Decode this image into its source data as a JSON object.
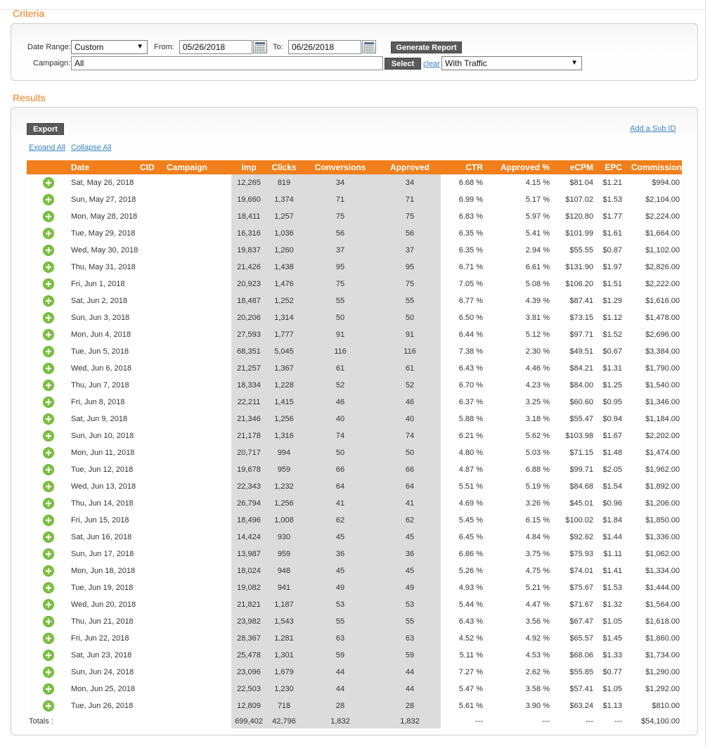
{
  "criteria": {
    "title": "Criteria",
    "date_range_label": "Date Range:",
    "date_range_value": "Custom",
    "from_label": "From:",
    "from_value": "05/26/2018",
    "to_label": "To:",
    "to_value": "06/26/2018",
    "generate_label": "Generate Report",
    "campaign_label": "Campaign:",
    "campaign_value": "All",
    "select_label": "Select",
    "clear_label": "clear",
    "traffic_value": "With Traffic"
  },
  "results": {
    "title": "Results",
    "export_label": "Export",
    "add_sub_id_label": "Add a Sub ID",
    "expand_all_label": "Expand All",
    "collapse_all_label": "Collapse All",
    "columns": [
      "Date",
      "CID",
      "Campaign",
      "Imp",
      "Clicks",
      "Conversions",
      "Approved",
      "CTR",
      "Approved %",
      "eCPM",
      "EPC",
      "Commission"
    ],
    "rows": [
      {
        "date": "Sat, May 26, 2018",
        "imp": "12,265",
        "clicks": "819",
        "conv": "34",
        "appr": "34",
        "ctr": "6.68 %",
        "apct": "4.15 %",
        "ecpm": "$81.04",
        "epc": "$1.21",
        "comm": "$994.00"
      },
      {
        "date": "Sun, May 27, 2018",
        "imp": "19,660",
        "clicks": "1,374",
        "conv": "71",
        "appr": "71",
        "ctr": "6.99 %",
        "apct": "5.17 %",
        "ecpm": "$107.02",
        "epc": "$1.53",
        "comm": "$2,104.00"
      },
      {
        "date": "Mon, May 28, 2018",
        "imp": "18,411",
        "clicks": "1,257",
        "conv": "75",
        "appr": "75",
        "ctr": "6.83 %",
        "apct": "5.97 %",
        "ecpm": "$120.80",
        "epc": "$1.77",
        "comm": "$2,224.00"
      },
      {
        "date": "Tue, May 29, 2018",
        "imp": "16,316",
        "clicks": "1,036",
        "conv": "56",
        "appr": "56",
        "ctr": "6.35 %",
        "apct": "5.41 %",
        "ecpm": "$101.99",
        "epc": "$1.61",
        "comm": "$1,664.00"
      },
      {
        "date": "Wed, May 30, 2018",
        "imp": "19,837",
        "clicks": "1,260",
        "conv": "37",
        "appr": "37",
        "ctr": "6.35 %",
        "apct": "2.94 %",
        "ecpm": "$55.55",
        "epc": "$0.87",
        "comm": "$1,102.00"
      },
      {
        "date": "Thu, May 31, 2018",
        "imp": "21,426",
        "clicks": "1,438",
        "conv": "95",
        "appr": "95",
        "ctr": "6.71 %",
        "apct": "6.61 %",
        "ecpm": "$131.90",
        "epc": "$1.97",
        "comm": "$2,826.00"
      },
      {
        "date": "Fri, Jun 1, 2018",
        "imp": "20,923",
        "clicks": "1,476",
        "conv": "75",
        "appr": "75",
        "ctr": "7.05 %",
        "apct": "5.08 %",
        "ecpm": "$106.20",
        "epc": "$1.51",
        "comm": "$2,222.00"
      },
      {
        "date": "Sat, Jun 2, 2018",
        "imp": "18,487",
        "clicks": "1,252",
        "conv": "55",
        "appr": "55",
        "ctr": "6.77 %",
        "apct": "4.39 %",
        "ecpm": "$87.41",
        "epc": "$1.29",
        "comm": "$1,616.00"
      },
      {
        "date": "Sun, Jun 3, 2018",
        "imp": "20,206",
        "clicks": "1,314",
        "conv": "50",
        "appr": "50",
        "ctr": "6.50 %",
        "apct": "3.81 %",
        "ecpm": "$73.15",
        "epc": "$1.12",
        "comm": "$1,478.00"
      },
      {
        "date": "Mon, Jun 4, 2018",
        "imp": "27,593",
        "clicks": "1,777",
        "conv": "91",
        "appr": "91",
        "ctr": "6.44 %",
        "apct": "5.12 %",
        "ecpm": "$97.71",
        "epc": "$1.52",
        "comm": "$2,696.00"
      },
      {
        "date": "Tue, Jun 5, 2018",
        "imp": "68,351",
        "clicks": "5,045",
        "conv": "116",
        "appr": "116",
        "ctr": "7.38 %",
        "apct": "2.30 %",
        "ecpm": "$49.51",
        "epc": "$0.67",
        "comm": "$3,384.00"
      },
      {
        "date": "Wed, Jun 6, 2018",
        "imp": "21,257",
        "clicks": "1,367",
        "conv": "61",
        "appr": "61",
        "ctr": "6.43 %",
        "apct": "4.46 %",
        "ecpm": "$84.21",
        "epc": "$1.31",
        "comm": "$1,790.00"
      },
      {
        "date": "Thu, Jun 7, 2018",
        "imp": "18,334",
        "clicks": "1,228",
        "conv": "52",
        "appr": "52",
        "ctr": "6.70 %",
        "apct": "4.23 %",
        "ecpm": "$84.00",
        "epc": "$1.25",
        "comm": "$1,540.00"
      },
      {
        "date": "Fri, Jun 8, 2018",
        "imp": "22,211",
        "clicks": "1,415",
        "conv": "46",
        "appr": "46",
        "ctr": "6.37 %",
        "apct": "3.25 %",
        "ecpm": "$60.60",
        "epc": "$0.95",
        "comm": "$1,346.00"
      },
      {
        "date": "Sat, Jun 9, 2018",
        "imp": "21,346",
        "clicks": "1,256",
        "conv": "40",
        "appr": "40",
        "ctr": "5.88 %",
        "apct": "3.18 %",
        "ecpm": "$55.47",
        "epc": "$0.94",
        "comm": "$1,184.00"
      },
      {
        "date": "Sun, Jun 10, 2018",
        "imp": "21,178",
        "clicks": "1,316",
        "conv": "74",
        "appr": "74",
        "ctr": "6.21 %",
        "apct": "5.62 %",
        "ecpm": "$103.98",
        "epc": "$1.67",
        "comm": "$2,202.00"
      },
      {
        "date": "Mon, Jun 11, 2018",
        "imp": "20,717",
        "clicks": "994",
        "conv": "50",
        "appr": "50",
        "ctr": "4.80 %",
        "apct": "5.03 %",
        "ecpm": "$71.15",
        "epc": "$1.48",
        "comm": "$1,474.00"
      },
      {
        "date": "Tue, Jun 12, 2018",
        "imp": "19,678",
        "clicks": "959",
        "conv": "66",
        "appr": "66",
        "ctr": "4.87 %",
        "apct": "6.88 %",
        "ecpm": "$99.71",
        "epc": "$2.05",
        "comm": "$1,962.00"
      },
      {
        "date": "Wed, Jun 13, 2018",
        "imp": "22,343",
        "clicks": "1,232",
        "conv": "64",
        "appr": "64",
        "ctr": "5.51 %",
        "apct": "5.19 %",
        "ecpm": "$84.68",
        "epc": "$1.54",
        "comm": "$1,892.00"
      },
      {
        "date": "Thu, Jun 14, 2018",
        "imp": "26,794",
        "clicks": "1,256",
        "conv": "41",
        "appr": "41",
        "ctr": "4.69 %",
        "apct": "3.26 %",
        "ecpm": "$45.01",
        "epc": "$0.96",
        "comm": "$1,206.00"
      },
      {
        "date": "Fri, Jun 15, 2018",
        "imp": "18,496",
        "clicks": "1,008",
        "conv": "62",
        "appr": "62",
        "ctr": "5.45 %",
        "apct": "6.15 %",
        "ecpm": "$100.02",
        "epc": "$1.84",
        "comm": "$1,850.00"
      },
      {
        "date": "Sat, Jun 16, 2018",
        "imp": "14,424",
        "clicks": "930",
        "conv": "45",
        "appr": "45",
        "ctr": "6.45 %",
        "apct": "4.84 %",
        "ecpm": "$92.62",
        "epc": "$1.44",
        "comm": "$1,336.00"
      },
      {
        "date": "Sun, Jun 17, 2018",
        "imp": "13,987",
        "clicks": "959",
        "conv": "36",
        "appr": "36",
        "ctr": "6.86 %",
        "apct": "3.75 %",
        "ecpm": "$75.93",
        "epc": "$1.11",
        "comm": "$1,062.00"
      },
      {
        "date": "Mon, Jun 18, 2018",
        "imp": "18,024",
        "clicks": "948",
        "conv": "45",
        "appr": "45",
        "ctr": "5.26 %",
        "apct": "4.75 %",
        "ecpm": "$74.01",
        "epc": "$1.41",
        "comm": "$1,334.00"
      },
      {
        "date": "Tue, Jun 19, 2018",
        "imp": "19,082",
        "clicks": "941",
        "conv": "49",
        "appr": "49",
        "ctr": "4.93 %",
        "apct": "5.21 %",
        "ecpm": "$75.67",
        "epc": "$1.53",
        "comm": "$1,444.00"
      },
      {
        "date": "Wed, Jun 20, 2018",
        "imp": "21,821",
        "clicks": "1,187",
        "conv": "53",
        "appr": "53",
        "ctr": "5.44 %",
        "apct": "4.47 %",
        "ecpm": "$71.67",
        "epc": "$1.32",
        "comm": "$1,564.00"
      },
      {
        "date": "Thu, Jun 21, 2018",
        "imp": "23,982",
        "clicks": "1,543",
        "conv": "55",
        "appr": "55",
        "ctr": "6.43 %",
        "apct": "3.56 %",
        "ecpm": "$67.47",
        "epc": "$1.05",
        "comm": "$1,618.00"
      },
      {
        "date": "Fri, Jun 22, 2018",
        "imp": "28,367",
        "clicks": "1,281",
        "conv": "63",
        "appr": "63",
        "ctr": "4.52 %",
        "apct": "4.92 %",
        "ecpm": "$65.57",
        "epc": "$1.45",
        "comm": "$1,860.00"
      },
      {
        "date": "Sat, Jun 23, 2018",
        "imp": "25,478",
        "clicks": "1,301",
        "conv": "59",
        "appr": "59",
        "ctr": "5.11 %",
        "apct": "4.53 %",
        "ecpm": "$68.06",
        "epc": "$1.33",
        "comm": "$1,734.00"
      },
      {
        "date": "Sun, Jun 24, 2018",
        "imp": "23,096",
        "clicks": "1,679",
        "conv": "44",
        "appr": "44",
        "ctr": "7.27 %",
        "apct": "2.62 %",
        "ecpm": "$55.85",
        "epc": "$0.77",
        "comm": "$1,290.00"
      },
      {
        "date": "Mon, Jun 25, 2018",
        "imp": "22,503",
        "clicks": "1,230",
        "conv": "44",
        "appr": "44",
        "ctr": "5.47 %",
        "apct": "3.58 %",
        "ecpm": "$57.41",
        "epc": "$1.05",
        "comm": "$1,292.00"
      },
      {
        "date": "Tue, Jun 26, 2018",
        "imp": "12,809",
        "clicks": "718",
        "conv": "28",
        "appr": "28",
        "ctr": "5.61 %",
        "apct": "3.90 %",
        "ecpm": "$63.24",
        "epc": "$1.13",
        "comm": "$810.00"
      }
    ],
    "totals": {
      "label": "Totals :",
      "imp": "699,402",
      "clicks": "42,796",
      "conv": "1,832",
      "appr": "1,832",
      "ctr": "---",
      "apct": "---",
      "ecpm": "---",
      "epc": "---",
      "comm": "$54,100.00"
    }
  },
  "colors": {
    "accent_orange": "#f07f1c",
    "commission_green": "#4c9a12",
    "expand_icon_green": "#7cc242",
    "link_blue": "#3a85c4"
  },
  "icons": {
    "row_expand": "plus-circle-icon",
    "calendar": "calendar-icon",
    "dropdown": "chevron-down-icon"
  }
}
